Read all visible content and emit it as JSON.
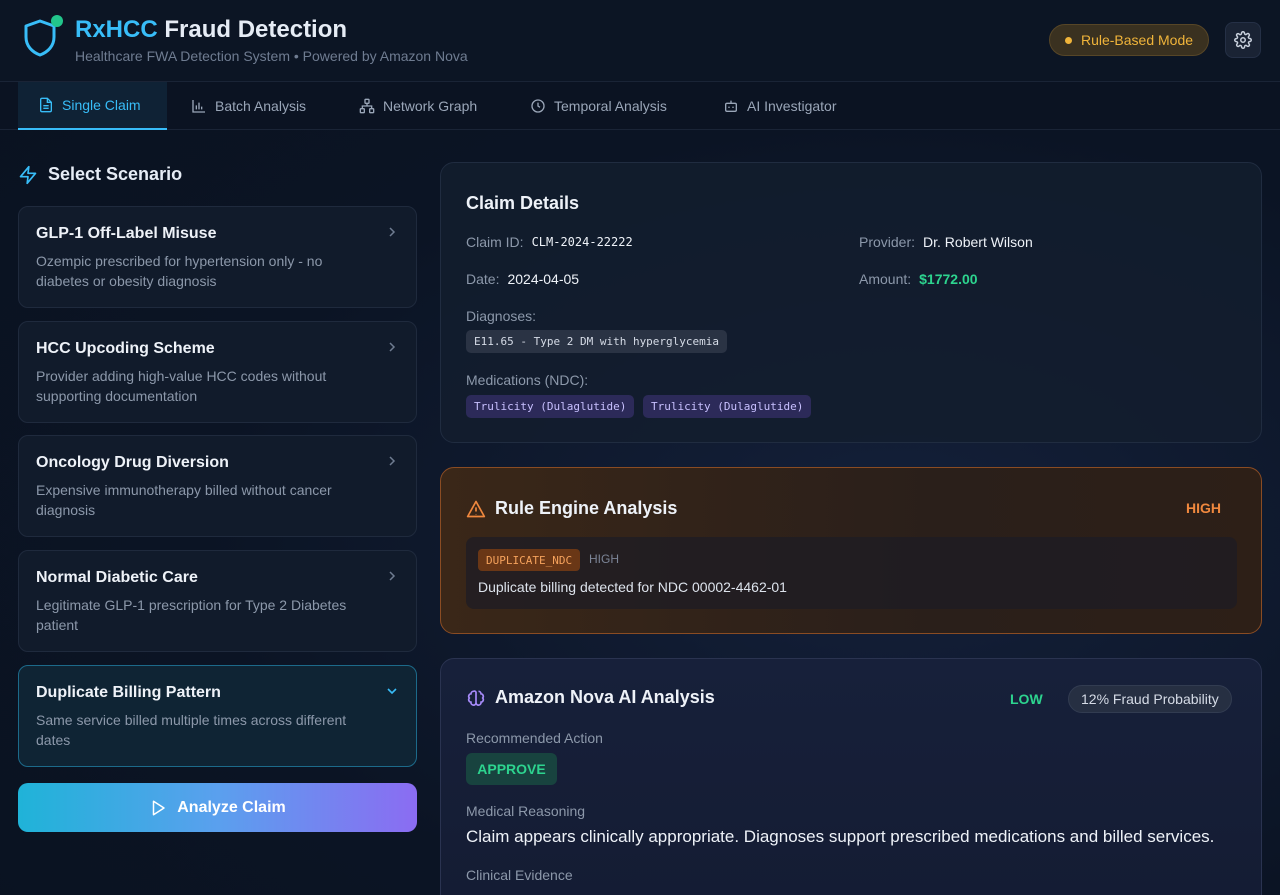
{
  "header": {
    "brand": "RxHCC",
    "title_rest": "Fraud Detection",
    "subtitle": "Healthcare FWA Detection System • Powered by Amazon Nova",
    "mode_badge": "Rule-Based Mode"
  },
  "tabs": [
    {
      "label": "Single Claim",
      "icon": "document-icon",
      "active": true
    },
    {
      "label": "Batch Analysis",
      "icon": "bar-chart-icon",
      "active": false
    },
    {
      "label": "Network Graph",
      "icon": "network-icon",
      "active": false
    },
    {
      "label": "Temporal Analysis",
      "icon": "clock-icon",
      "active": false
    },
    {
      "label": "AI Investigator",
      "icon": "bot-icon",
      "active": false
    }
  ],
  "scenarios": {
    "heading": "Select Scenario",
    "items": [
      {
        "title": "GLP-1 Off-Label Misuse",
        "desc": "Ozempic prescribed for hypertension only - no diabetes or obesity diagnosis"
      },
      {
        "title": "HCC Upcoding Scheme",
        "desc": "Provider adding high-value HCC codes without supporting documentation"
      },
      {
        "title": "Oncology Drug Diversion",
        "desc": "Expensive immunotherapy billed without cancer diagnosis"
      },
      {
        "title": "Normal Diabetic Care",
        "desc": "Legitimate GLP-1 prescription for Type 2 Diabetes patient"
      },
      {
        "title": "Duplicate Billing Pattern",
        "desc": "Same service billed multiple times across different dates",
        "selected": true
      }
    ],
    "analyze_button": "Analyze Claim"
  },
  "claim": {
    "title": "Claim Details",
    "claim_id_label": "Claim ID:",
    "claim_id": "CLM-2024-22222",
    "provider_label": "Provider:",
    "provider": "Dr. Robert Wilson",
    "date_label": "Date:",
    "date": "2024-04-05",
    "amount_label": "Amount:",
    "amount": "$1772.00",
    "diagnoses_label": "Diagnoses:",
    "diagnoses": [
      "E11.65 - Type 2 DM with hyperglycemia"
    ],
    "medications_label": "Medications (NDC):",
    "medications": [
      "Trulicity (Dulaglutide)",
      "Trulicity (Dulaglutide)"
    ]
  },
  "rule_engine": {
    "title": "Rule Engine Analysis",
    "severity": "HIGH",
    "finding": {
      "code": "DUPLICATE_NDC",
      "severity": "HIGH",
      "message": "Duplicate billing detected for NDC 00002-4462-01"
    }
  },
  "nova": {
    "title": "Amazon Nova AI Analysis",
    "risk": "LOW",
    "probability": "12% Fraud Probability",
    "recommended_label": "Recommended Action",
    "action": "APPROVE",
    "reasoning_label": "Medical Reasoning",
    "reasoning": "Claim appears clinically appropriate. Diagnoses support prescribed medications and billed services.",
    "evidence_label": "Clinical Evidence"
  },
  "colors": {
    "accent": "#38bdf8",
    "warning": "#f0883e",
    "success": "#2dd48f",
    "mode": "#f0b43a"
  }
}
